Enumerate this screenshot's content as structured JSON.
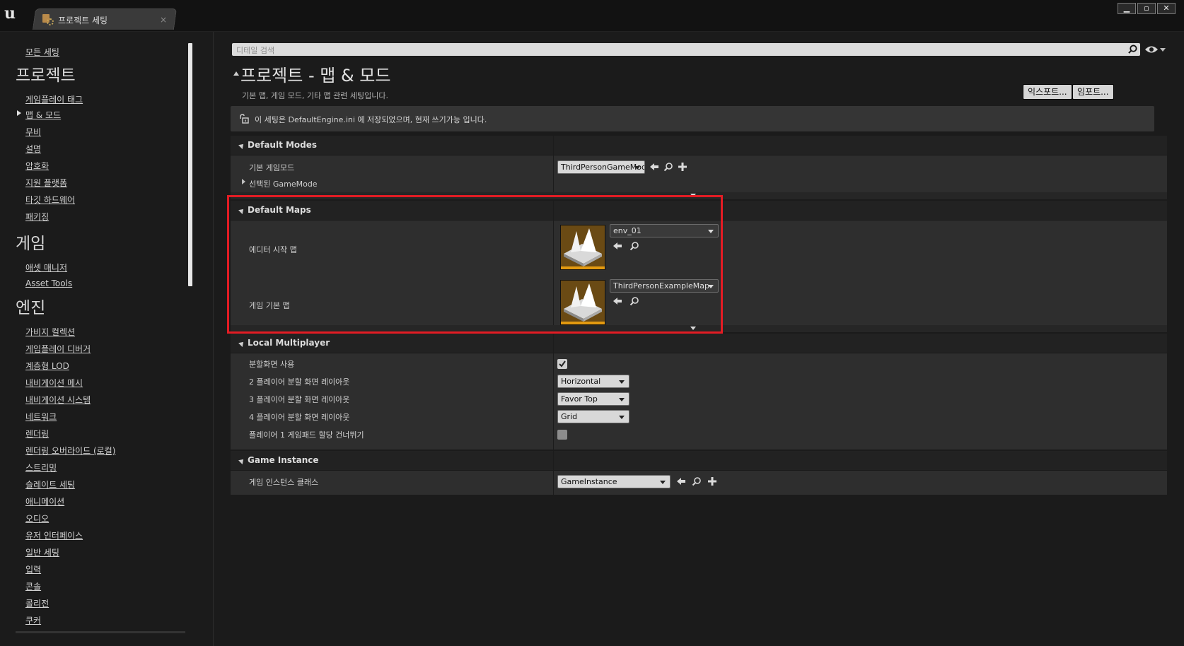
{
  "window": {
    "tab_title": "프로젝트 세팅",
    "tab_close": "×",
    "controls": [
      "▁",
      "▫",
      "✕"
    ]
  },
  "sidebar": {
    "all_settings": "모든 세팅",
    "categories": [
      {
        "title": "프로젝트",
        "items": [
          "게임플레이 태그",
          "맵 & 모드",
          "무비",
          "설명",
          "암호화",
          "지원 플랫폼",
          "타깃 하드웨어",
          "패키징"
        ]
      },
      {
        "title": "게임",
        "items": [
          "애셋 매니저",
          "Asset Tools"
        ]
      },
      {
        "title": "엔진",
        "items": [
          "가비지 컬렉션",
          "게임플레이 디버거",
          "계층형 LOD",
          "내비게이션 메시",
          "내비게이션 시스템",
          "네트워크",
          "렌더링",
          "렌더링 오버라이드 (로컬)",
          "스트리밍",
          "슬레이트 세팅",
          "애니메이션",
          "오디오",
          "유저 인터페이스",
          "일반 세팅",
          "입력",
          "콘솔",
          "콜리전",
          "쿠커"
        ]
      }
    ],
    "selected_item": "맵 & 모드"
  },
  "search": {
    "placeholder": "디테일 검색"
  },
  "page": {
    "title": "프로젝트 - 맵 & 모드",
    "description": "기본 맵, 게임 모드, 기타 맵 관련 세팅입니다.",
    "export_label": "익스포트...",
    "import_label": "임포트...",
    "info": "이 세팅은 DefaultEngine.ini 에 저장되었으며, 현재 쓰기가능 입니다."
  },
  "sections": {
    "default_modes": {
      "title": "Default Modes",
      "default_gamemode_label": "기본 게임모드",
      "default_gamemode_value": "ThirdPersonGameMode",
      "selected_gamemode_label": "선택된 GameMode"
    },
    "default_maps": {
      "title": "Default Maps",
      "editor_startup_label": "에디터 시작 맵",
      "editor_startup_value": "env_01",
      "game_default_label": "게임 기본 맵",
      "game_default_value": "ThirdPersonExampleMap"
    },
    "local_multiplayer": {
      "title": "Local Multiplayer",
      "splitscreen_label": "분할화면 사용",
      "splitscreen_checked": true,
      "two_player_label": "2 플레이어 분할 화면 레이아웃",
      "two_player_value": "Horizontal",
      "three_player_label": "3 플레이어 분할 화면 레이아웃",
      "three_player_value": "Favor Top",
      "four_player_label": "4 플레이어 분할 화면 레이아웃",
      "four_player_value": "Grid",
      "skip_gamepad_label": "플레이어 1 게임패드 할당 건너뛰기",
      "skip_gamepad_checked": false
    },
    "game_instance": {
      "title": "Game Instance",
      "class_label": "게임 인스턴스 클래스",
      "class_value": "GameInstance"
    }
  },
  "colors": {
    "highlight_box": "#e31c24",
    "thumbnail_accent": "#e39a10",
    "thumbnail_bg": "#6a4a14"
  }
}
